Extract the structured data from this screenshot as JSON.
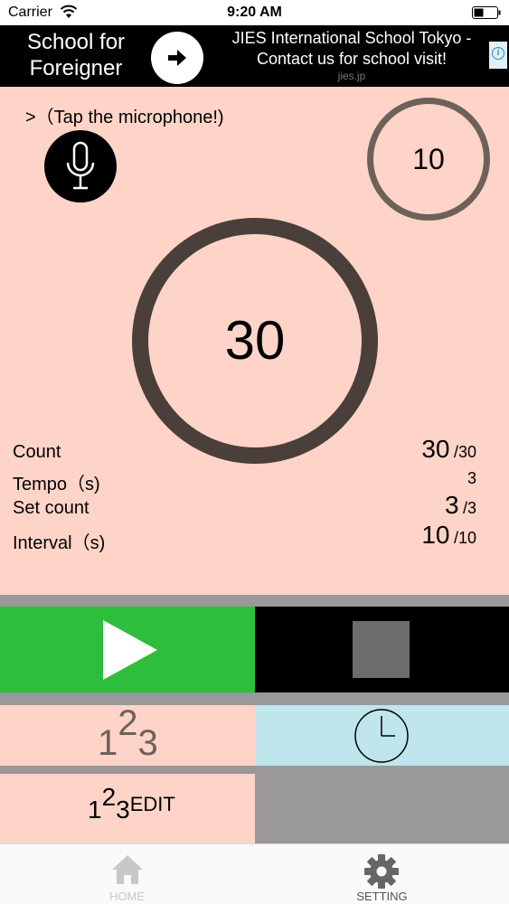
{
  "status_bar": {
    "carrier": "Carrier",
    "time": "9:20 AM"
  },
  "ad": {
    "title": "School for Foreigner",
    "headline": "JIES International School Tokyo - Contact us for school visit!",
    "domain": "jies.jp"
  },
  "hint": ">（Tap the microphone!)",
  "interval_timer": {
    "value": "10"
  },
  "main_counter": {
    "value": "30"
  },
  "stats": {
    "count": {
      "label": "Count",
      "value": "30",
      "total": "/30"
    },
    "tempo": {
      "label": "Tempo（s)",
      "value": "3"
    },
    "set_count": {
      "label": "Set count",
      "value": "3",
      "total": "/3"
    },
    "interval": {
      "label": "Interval（s)",
      "value": "10",
      "total": "/10"
    }
  },
  "count_mode": {
    "d1": "1",
    "d2": "2",
    "d3": "3"
  },
  "edit_button": {
    "d1": "1",
    "d2": "2",
    "d3": "3",
    "label": "EDIT"
  },
  "tab_bar": {
    "home": "HOME",
    "setting": "SETTING"
  },
  "colors": {
    "background": "#ffd4c8",
    "play": "#2dbe3b",
    "stop": "#000000",
    "timer_mode": "#bfe5ed",
    "ring_dark": "#4a3f3a"
  }
}
